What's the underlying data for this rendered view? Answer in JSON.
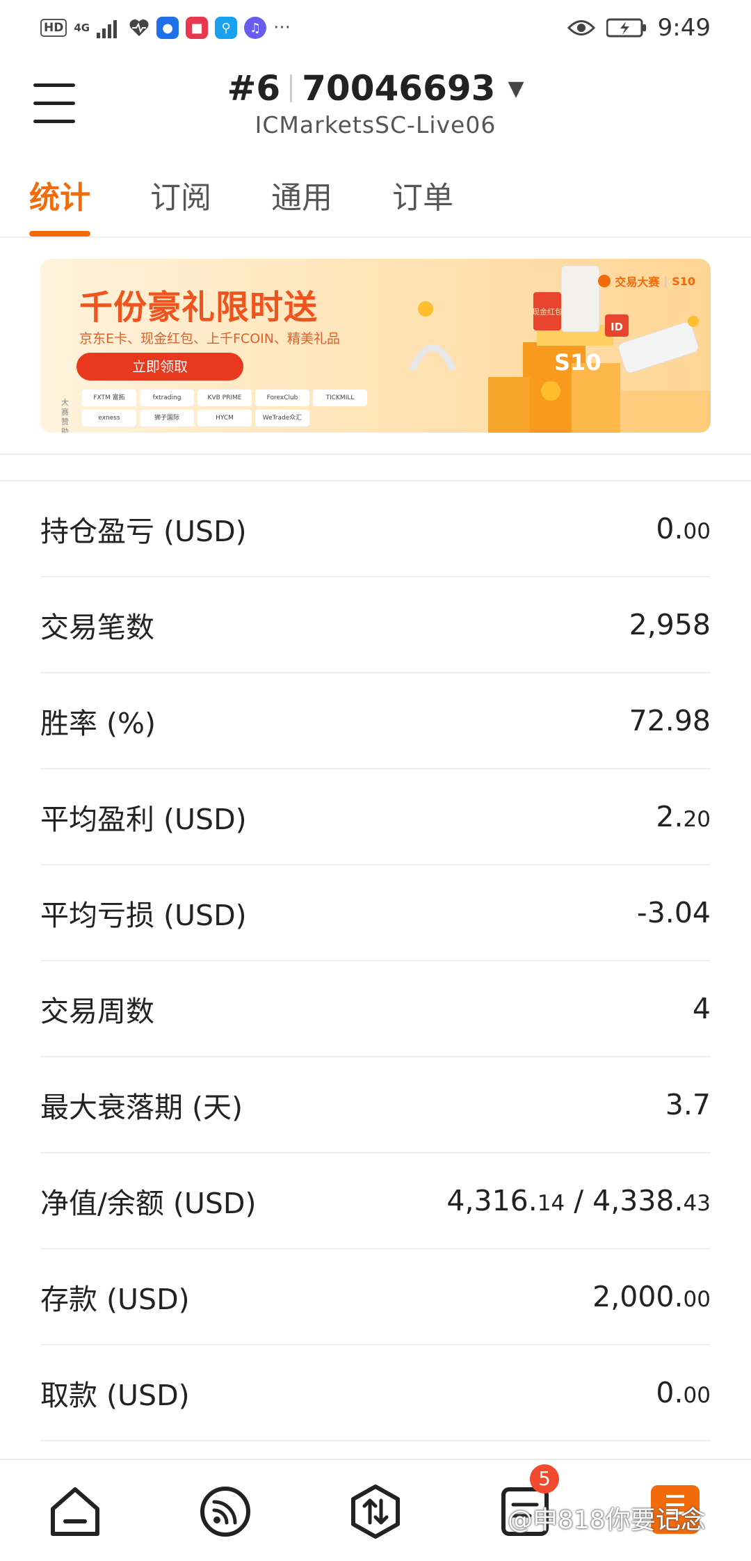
{
  "status_bar": {
    "hd": "HD",
    "network": "4G",
    "time": "9:49",
    "more": "···"
  },
  "header": {
    "account_index": "#6",
    "account_number": "70046693",
    "server": "ICMarketsSC-Live06"
  },
  "tabs": [
    {
      "label": "统计",
      "active": true
    },
    {
      "label": "订阅",
      "active": false
    },
    {
      "label": "通用",
      "active": false
    },
    {
      "label": "订单",
      "active": false
    }
  ],
  "banner": {
    "title": "千份豪礼限时送",
    "subtitle": "京东E卡、现金红包、上千FCOIN、精美礼品",
    "button": "立即领取",
    "brand": "交易大赛",
    "brand_tag": "S10",
    "sponsor_label": "大赛赞助",
    "sponsors": [
      "FXTM 富拓",
      "fxtrading",
      "KVB PRIME",
      "ForexClub",
      "TICKMILL",
      "exness",
      "狮子国际",
      "HYCM",
      "WeTrade众汇"
    ],
    "gift_text_1": "现金红包",
    "gift_text_2": "ID",
    "gift_text_3": "S10"
  },
  "stats": [
    {
      "label": "持仓盈亏 (USD)",
      "value_main": "0.",
      "value_small": "00"
    },
    {
      "label": "交易笔数",
      "value_main": "2,958",
      "value_small": ""
    },
    {
      "label": "胜率 (%)",
      "value_main": "72.98",
      "value_small": ""
    },
    {
      "label": "平均盈利 (USD)",
      "value_main": "2.",
      "value_small": "20"
    },
    {
      "label": "平均亏损 (USD)",
      "value_main": "-3.04",
      "value_small": ""
    },
    {
      "label": "交易周数",
      "value_main": "4",
      "value_small": ""
    },
    {
      "label": "最大衰落期 (天)",
      "value_main": "3.7",
      "value_small": ""
    },
    {
      "label": "净值/余额 (USD)",
      "value_main": "4,316.",
      "value_small": "14",
      "value_main2": " / 4,338.",
      "value_small2": "43"
    },
    {
      "label": "存款 (USD)",
      "value_main": "2,000.",
      "value_small": "00"
    },
    {
      "label": "取款 (USD)",
      "value_main": "0.",
      "value_small": "00"
    }
  ],
  "bottom_nav": {
    "badge_count": "5",
    "watermark": "@申818你要记念"
  },
  "colors": {
    "accent": "#f26a0a",
    "badge": "#f24a2e",
    "banner_button": "#e8381d"
  }
}
